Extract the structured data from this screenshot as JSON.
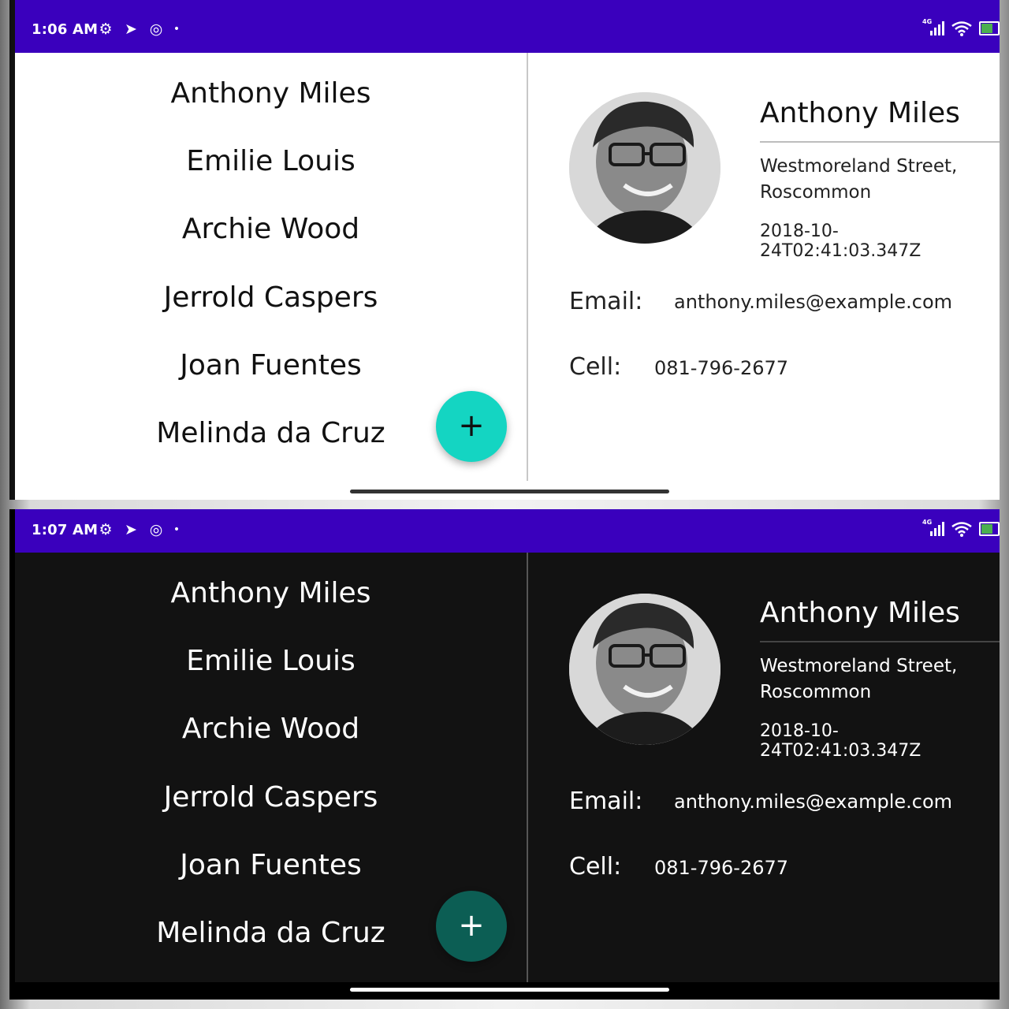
{
  "panels": [
    {
      "theme": "light",
      "status": {
        "time": "1:06 AM",
        "network": "4G"
      },
      "contacts": [
        "Anthony Miles",
        "Emilie Louis",
        "Archie Wood",
        "Jerrold Caspers",
        "Joan Fuentes",
        "Melinda da Cruz"
      ],
      "fab_label": "+",
      "detail": {
        "name": "Anthony Miles",
        "address_line1": "Westmoreland Street,",
        "address_line2": "Roscommon",
        "timestamp": "2018-10-24T02:41:03.347Z",
        "email_label": "Email:",
        "email": "anthony.miles@example.com",
        "cell_label": "Cell:",
        "cell": "081-796-2677"
      }
    },
    {
      "theme": "dark",
      "status": {
        "time": "1:07 AM",
        "network": "4G"
      },
      "contacts": [
        "Anthony Miles",
        "Emilie Louis",
        "Archie Wood",
        "Jerrold Caspers",
        "Joan Fuentes",
        "Melinda da Cruz"
      ],
      "fab_label": "+",
      "detail": {
        "name": "Anthony Miles",
        "address_line1": "Westmoreland Street,",
        "address_line2": "Roscommon",
        "timestamp": "2018-10-24T02:41:03.347Z",
        "email_label": "Email:",
        "email": "anthony.miles@example.com",
        "cell_label": "Cell:",
        "cell": "081-796-2677"
      }
    }
  ],
  "colors": {
    "status_bar": "#3a00bd",
    "fab_light": "#14d5c2",
    "fab_dark": "#0c5e54",
    "dark_background": "#121212"
  },
  "icons": {
    "status_left": [
      "settings-icon",
      "telegram-icon",
      "data-saver-icon",
      "dot-icon"
    ],
    "status_right": [
      "signal-icon",
      "wifi-icon",
      "battery-icon"
    ],
    "fab": "plus-icon"
  }
}
